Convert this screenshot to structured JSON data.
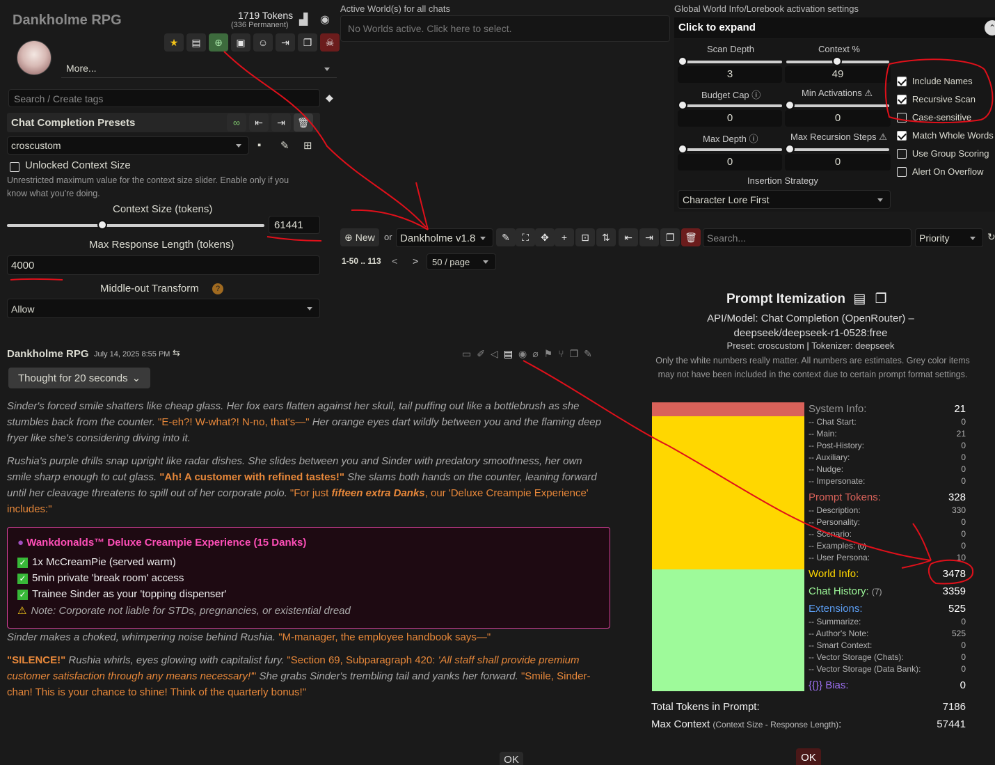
{
  "char": {
    "name": "Dankholme RPG",
    "tokens": "1719 Tokens",
    "permanent": "(336 Permanent)",
    "more": "More...",
    "tag_placeholder": "Search / Create tags"
  },
  "presets": {
    "title": "Chat Completion Presets",
    "selected": "croscustom",
    "unlocked_label": "Unlocked Context Size",
    "unlocked_help": "Unrestricted maximum value for the context size slider. Enable only if you know what you're doing.",
    "context_label": "Context Size (tokens)",
    "context_value": "61441",
    "context_fraction": 0.37,
    "max_resp_label": "Max Response Length (tokens)",
    "max_resp_value": "4000",
    "middle_out_label": "Middle-out Transform",
    "middle_out_value": "Allow"
  },
  "worlds": {
    "active_label": "Active World(s) for all chats",
    "active_placeholder": "No Worlds active. Click here to select.",
    "global_label": "Global World Info/Lorebook activation settings",
    "expand": "Click to expand",
    "scan_depth_label": "Scan Depth",
    "scan_depth": "3",
    "context_pct_label": "Context %",
    "context_pct": "49",
    "budget_cap_label": "Budget Cap",
    "budget_cap": "0",
    "min_act_label": "Min Activations",
    "min_act": "0",
    "max_depth_label": "Max Depth",
    "max_depth": "0",
    "max_rec_label": "Max Recursion Steps",
    "max_rec": "0",
    "insertion_label": "Insertion Strategy",
    "insertion_value": "Character Lore First",
    "checks": [
      {
        "label": "Include Names",
        "on": true
      },
      {
        "label": "Recursive Scan",
        "on": true
      },
      {
        "label": "Case-sensitive",
        "on": false
      },
      {
        "label": "Match Whole Words",
        "on": true
      },
      {
        "label": "Use Group Scoring",
        "on": false
      },
      {
        "label": "Alert On Overflow",
        "on": false
      }
    ],
    "new_label": "New",
    "or_label": "or",
    "book": "Dankholme v1.8",
    "search_placeholder": "Search...",
    "sort": "Priority",
    "pager_range": "1-50 .. 113",
    "pager_prev": "<",
    "pager_next": ">",
    "per_page": "50 / page"
  },
  "message": {
    "author": "Dankholme RPG",
    "date": "July 14, 2025 8:55 PM",
    "thought": "Thought for 20 seconds",
    "p1a": "Sinder's forced smile shatters like cheap glass. Her fox ears flatten against her skull, tail puffing out like a bottlebrush as she stumbles back from the counter. ",
    "p1q": "\"E-eh?! W-what?! N-no, that's—\"",
    "p1b": " Her orange eyes dart wildly between you and the flaming deep fryer like she's considering diving into it.",
    "p2a": "Rushia's purple drills snap upright like radar dishes. She slides between you and Sinder with predatory smoothness, her own smile sharp enough to cut glass. ",
    "p2q": "\"Ah! A customer with refined tastes!\"",
    "p2b": " She slams both hands on the counter, leaning forward until her cleavage threatens to spill out of her corporate polo. ",
    "p2q2a": "\"For just ",
    "p2q2em": "fifteen extra Danks",
    "p2q2b": ", our 'Deluxe Creampie Experience' includes:\"",
    "box_title": "Wankdonalds™ Deluxe Creampie Experience (15 Danks)",
    "box_items": [
      "1x McCreamPie (served warm)",
      "5min private 'break room' access",
      "Trainee Sinder as your 'topping dispenser'"
    ],
    "box_note": "Note: Corporate not liable for STDs, pregnancies, or existential dread",
    "p3a": "Sinder makes a choked, whimpering noise behind Rushia. ",
    "p3q": "\"M-manager, the employee handbook says—\"",
    "p4q1": "\"SILENCE!\"",
    "p4a": " Rushia whirls, eyes glowing with capitalist fury. ",
    "p4q2a": "\"Section 69, Subparagraph 420: ",
    "p4q2em": "'All staff shall provide premium customer satisfaction through any means necessary!'",
    "p4q2b": "\"",
    "p4b": " She grabs Sinder's trembling tail and yanks her forward. ",
    "p4q3": "\"Smile, Sinder-chan! This is your chance to shine! Think of the quarterly bonus!\""
  },
  "itemization": {
    "title": "Prompt Itemization",
    "api": "API/Model: Chat Completion (OpenRouter) – deepseek/deepseek-r1-0528:free",
    "preset": "Preset: croscustom",
    "tokenizer": "Tokenizer: deepseek",
    "note": "Only the white numbers really matter. All numbers are estimates. Grey color items may not have been included in the context due to certain prompt format settings.",
    "system_label": "System Info:",
    "system_value": "21",
    "system_items": [
      [
        "-- Chat Start:",
        "0"
      ],
      [
        "-- Main:",
        "21"
      ],
      [
        "-- Post-History:",
        "0"
      ],
      [
        "-- Auxiliary:",
        "0"
      ],
      [
        "-- Nudge:",
        "0"
      ],
      [
        "-- Impersonate:",
        "0"
      ]
    ],
    "prompt_label": "Prompt Tokens:",
    "prompt_value": "328",
    "prompt_items": [
      [
        "-- Description:",
        "330"
      ],
      [
        "-- Personality:",
        "0"
      ],
      [
        "-- Scenario:",
        "0"
      ],
      [
        "-- Examples:",
        "0"
      ],
      [
        "-- User Persona:",
        "10"
      ]
    ],
    "examples_count": "(0)",
    "world_label": "World Info:",
    "world_value": "3478",
    "chat_label": "Chat History:",
    "chat_count": "(7)",
    "chat_value": "3359",
    "ext_label": "Extensions:",
    "ext_value": "525",
    "ext_items": [
      [
        "-- Summarize:",
        "0"
      ],
      [
        "-- Author's Note:",
        "525"
      ],
      [
        "-- Smart Context:",
        "0"
      ],
      [
        "-- Vector Storage (Chats):",
        "0"
      ],
      [
        "-- Vector Storage (Data Bank):",
        "0"
      ]
    ],
    "bias_label": "{{}} Bias:",
    "bias_value": "0",
    "total_label": "Total Tokens in Prompt:",
    "total_value": "7186",
    "max_label": "Max Context",
    "max_sub": "(Context Size - Response Length)",
    "max_colon": ":",
    "max_value": "57441",
    "ok": "OK",
    "bar_colors": {
      "system": "#d9625a",
      "prompt": "#ffd700",
      "chat": "#9efa9a"
    }
  },
  "ok_left": "OK"
}
